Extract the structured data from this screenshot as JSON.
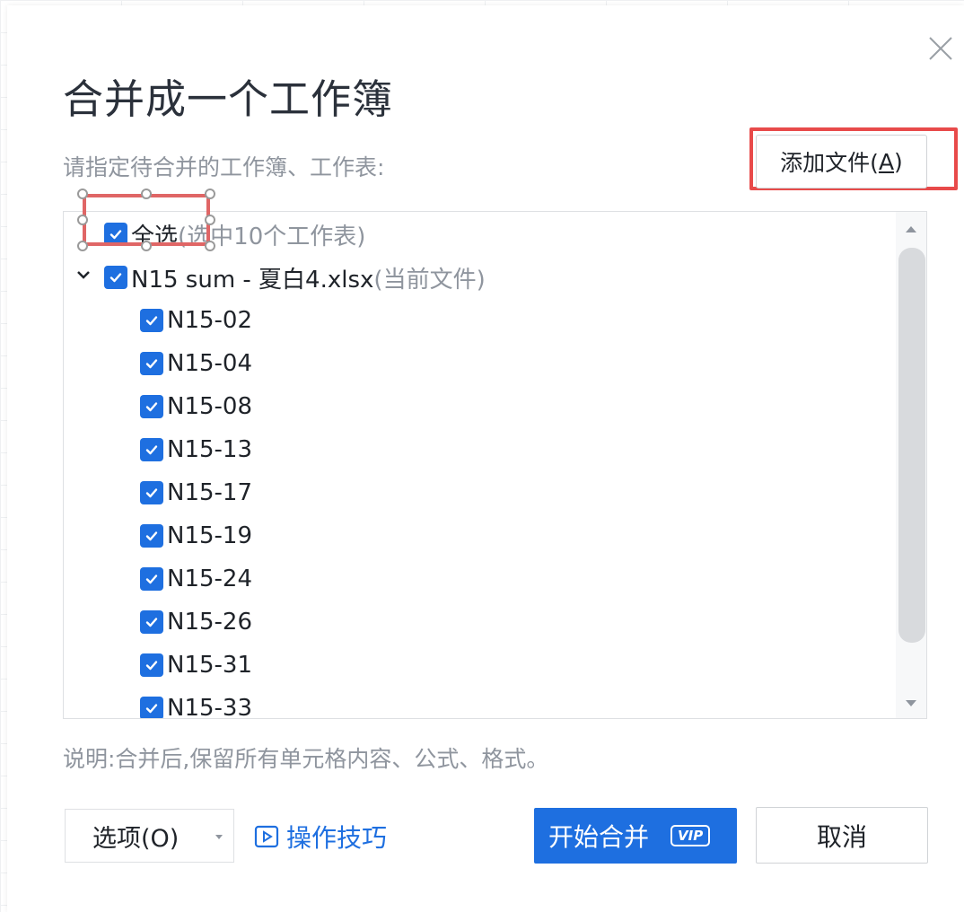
{
  "dialog": {
    "title": "合并成一个工作簿",
    "subtitle": "请指定待合并的工作簿、工作表:",
    "add_file_label": "添加文件(",
    "add_file_accel": "A",
    "add_file_close": ")"
  },
  "list": {
    "select_all_label": "全选",
    "select_all_note": "(选中10个工作表)",
    "file_name": "N15 sum - 夏白4.xlsx",
    "file_note": "(当前文件)",
    "sheets": [
      "N15-02",
      "N15-04",
      "N15-08",
      "N15-13",
      "N15-17",
      "N15-19",
      "N15-24",
      "N15-26",
      "N15-31",
      "N15-33"
    ]
  },
  "note": "说明:合并后,保留所有单元格内容、公式、格式。",
  "footer": {
    "options_label": "选项(O)",
    "tips_label": "操作技巧",
    "start_label": "开始合并",
    "vip_badge": "VIP",
    "cancel_label": "取消"
  },
  "colors": {
    "accent": "#1e6fe0",
    "highlight": "#e84a4a",
    "muted_text": "#8f959e"
  },
  "icons": {
    "close": "close-icon",
    "checkbox": "checkbox-checked-icon",
    "expand": "chevron-down-icon",
    "tips": "play-video-icon"
  }
}
